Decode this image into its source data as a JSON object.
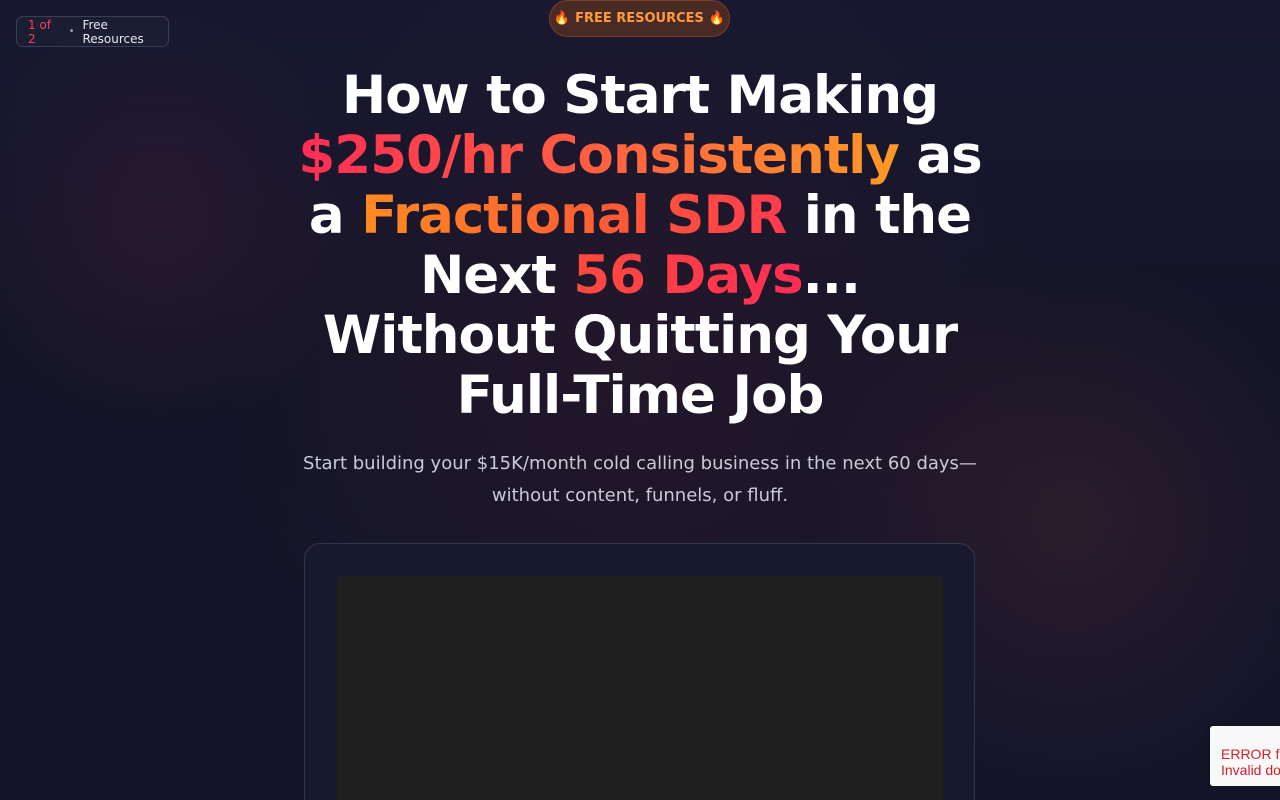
{
  "step_indicator": {
    "count": "1 of 2",
    "separator": "•",
    "label": "Free Resources"
  },
  "badge": {
    "icon": "fire-icon",
    "emoji": "🔥",
    "label": "FREE RESOURCES"
  },
  "headline": {
    "line1": "How to Start Making",
    "line2_highlight": "$250/hr Consistently",
    "line2_rest": " as",
    "line3_start": "a ",
    "line3_highlight": "Fractional SDR",
    "line3_rest": " in the",
    "line4_start": "Next ",
    "line4_highlight": "56 Days",
    "line4_rest": "...",
    "line5": "Without Quitting Your",
    "line6": "Full-Time Job"
  },
  "subtitle": {
    "line1": "Start building your $15K/month cold calling business in the next 60 days—",
    "line2": "without content, funnels, or fluff."
  },
  "recaptcha": {
    "line1": "ERROR for site owner:",
    "line2": "Invalid domain for site key"
  },
  "colors": {
    "background": "#141527",
    "accent_red": "#ff2d55",
    "accent_orange": "#ff8a1f",
    "badge_bg": "#4a2a25"
  }
}
